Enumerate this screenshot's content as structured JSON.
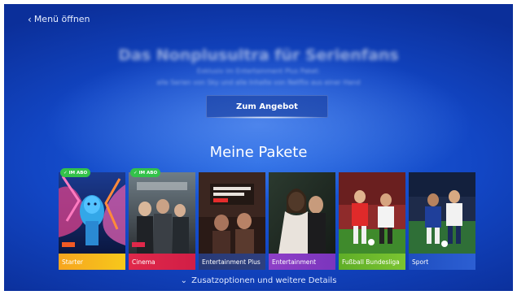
{
  "nav": {
    "back_label": "Menü öffnen"
  },
  "hero": {
    "title": "Das Nonplusultra für Serienfans",
    "subtitle": "Exklusiv im Entertainment Plus Paket:",
    "description": "alle Serien von Sky und alle Inhalte von Netflix aus einer Hand",
    "cta_label": "Zum Angebot"
  },
  "packages": {
    "title": "Meine Pakete",
    "badge_label": "IM ABO",
    "items": [
      {
        "name": "Starter",
        "subscribed": true,
        "label_color": "#f7a51f",
        "label_color2": "#f6c81b"
      },
      {
        "name": "Cinema",
        "subscribed": true,
        "label_color": "#e0284a",
        "label_color2": "#d11e46"
      },
      {
        "name": "Entertainment Plus",
        "subscribed": false,
        "label_color": "#283a77",
        "label_color2": "#2e3f7e"
      },
      {
        "name": "Entertainment",
        "subscribed": false,
        "label_color": "#8e3fc7",
        "label_color2": "#7b35bd"
      },
      {
        "name": "Fußball Bundesliga",
        "subscribed": false,
        "label_color": "#5fae27",
        "label_color2": "#7bc431"
      },
      {
        "name": "Sport",
        "subscribed": false,
        "label_color": "#1f4ec0",
        "label_color2": "#2c5fd3"
      }
    ]
  },
  "footer": {
    "details_label": "Zusatzoptionen und weitere Details"
  },
  "colors": {
    "background": "#1246c4",
    "badge": "#33c24a"
  }
}
